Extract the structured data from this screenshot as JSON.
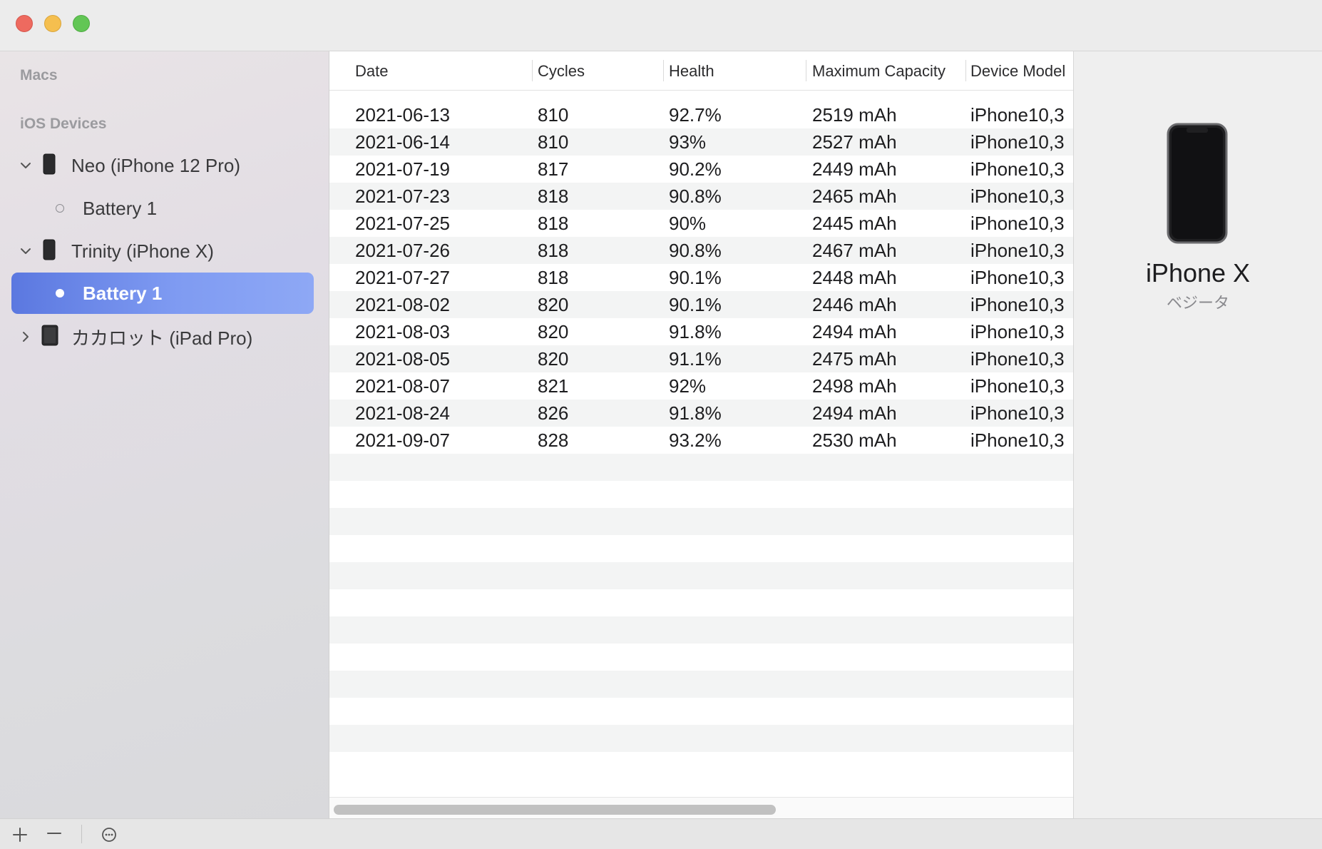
{
  "window": {
    "controls": [
      "close",
      "minimize",
      "zoom"
    ]
  },
  "sidebar": {
    "sections": {
      "macs": "Macs",
      "ios_devices": "iOS Devices"
    },
    "devices": [
      {
        "name": "Neo (iPhone 12 Pro)",
        "icon": "iphone-icon",
        "expanded": true,
        "battery": "Battery 1",
        "battery_selected": false
      },
      {
        "name": "Trinity (iPhone X)",
        "icon": "iphone-icon",
        "expanded": true,
        "battery": "Battery 1",
        "battery_selected": true
      },
      {
        "name": "カカロット (iPad Pro)",
        "icon": "ipad-icon",
        "expanded": false
      }
    ]
  },
  "table": {
    "columns": [
      "Date",
      "Cycles",
      "Health",
      "Maximum Capacity",
      "Device Model"
    ],
    "rows": [
      [
        "2021-06-13",
        "810",
        "92.7%",
        "2519 mAh",
        "iPhone10,3"
      ],
      [
        "2021-06-14",
        "810",
        "93%",
        "2527 mAh",
        "iPhone10,3"
      ],
      [
        "2021-07-19",
        "817",
        "90.2%",
        "2449 mAh",
        "iPhone10,3"
      ],
      [
        "2021-07-23",
        "818",
        "90.8%",
        "2465 mAh",
        "iPhone10,3"
      ],
      [
        "2021-07-25",
        "818",
        "90%",
        "2445 mAh",
        "iPhone10,3"
      ],
      [
        "2021-07-26",
        "818",
        "90.8%",
        "2467 mAh",
        "iPhone10,3"
      ],
      [
        "2021-07-27",
        "818",
        "90.1%",
        "2448 mAh",
        "iPhone10,3"
      ],
      [
        "2021-08-02",
        "820",
        "90.1%",
        "2446 mAh",
        "iPhone10,3"
      ],
      [
        "2021-08-03",
        "820",
        "91.8%",
        "2494 mAh",
        "iPhone10,3"
      ],
      [
        "2021-08-05",
        "820",
        "91.1%",
        "2475 mAh",
        "iPhone10,3"
      ],
      [
        "2021-08-07",
        "821",
        "92%",
        "2498 mAh",
        "iPhone10,3"
      ],
      [
        "2021-08-24",
        "826",
        "91.8%",
        "2494 mAh",
        "iPhone10,3"
      ],
      [
        "2021-09-07",
        "828",
        "93.2%",
        "2530 mAh",
        "iPhone10,3"
      ]
    ]
  },
  "detail": {
    "device_name": "iPhone X",
    "subtitle": "ベジータ",
    "image": "iphone-x-image"
  },
  "bottom_bar": {
    "buttons": [
      "add-icon",
      "remove-icon",
      "more-icon"
    ]
  },
  "colors": {
    "selection_start": "#5b78e0",
    "selection_end": "#8ea8f5",
    "close": "#ee6a5f",
    "minimize": "#f5bf4f",
    "zoom": "#62c655"
  }
}
